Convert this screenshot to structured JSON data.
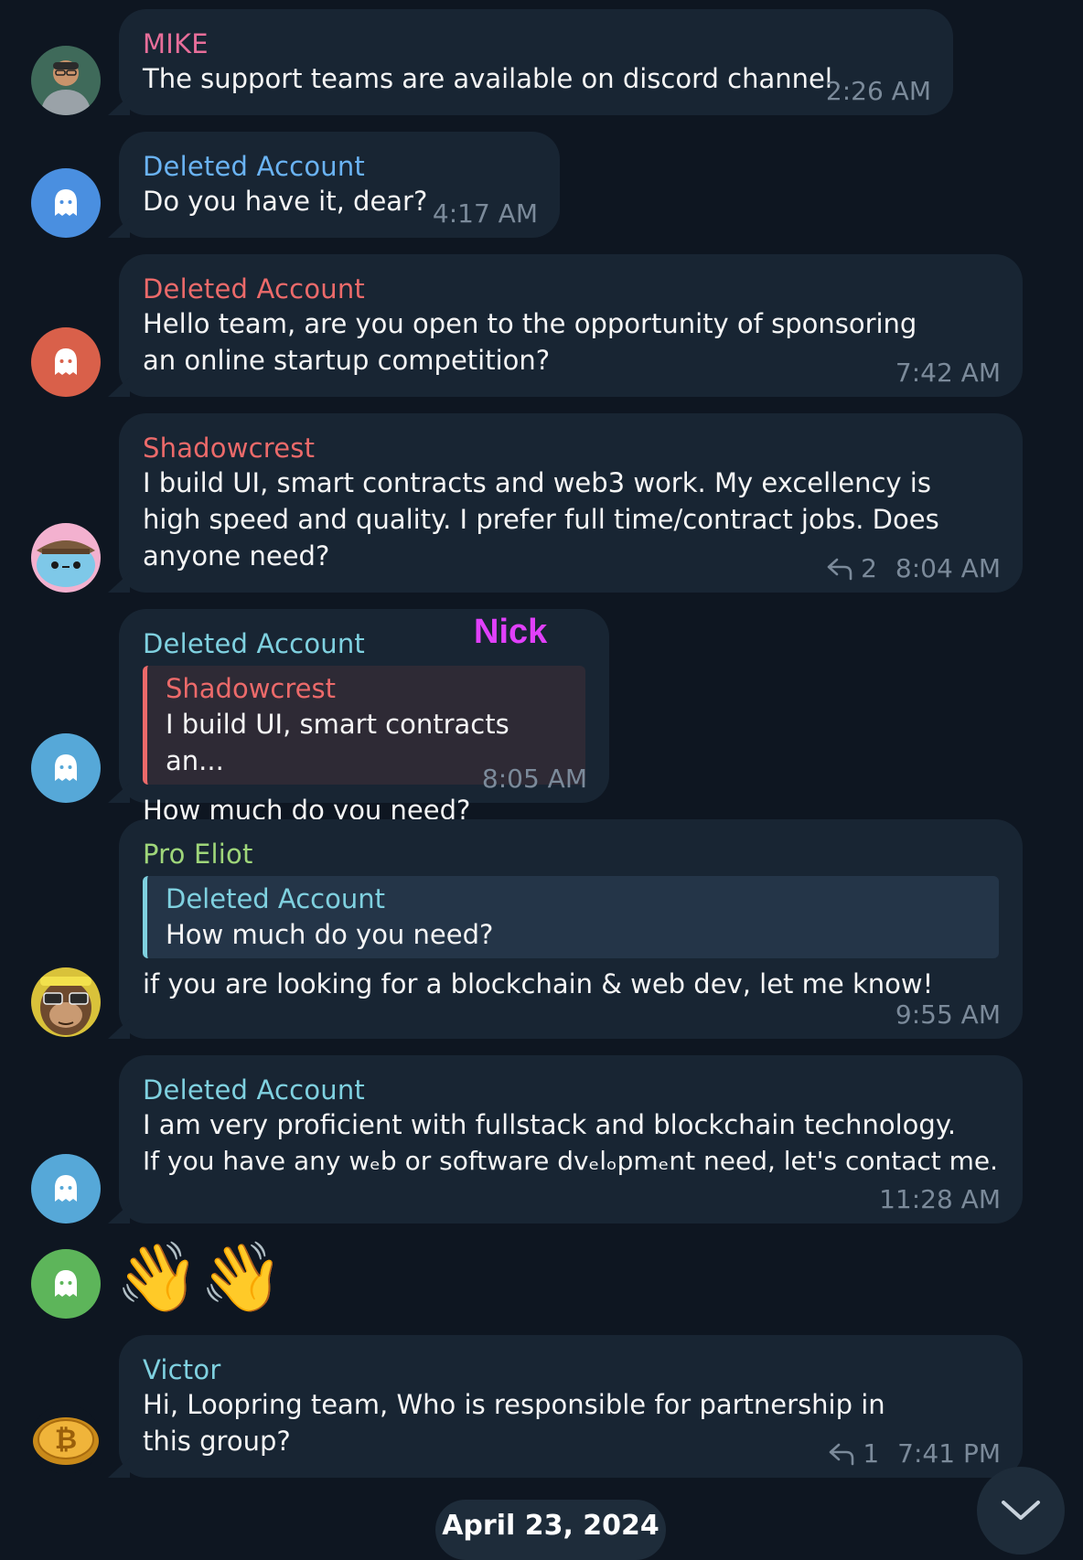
{
  "colors": {
    "background": "#0e1621",
    "bubble": "#182533",
    "timestamp": "#7b8a9a",
    "mike": "#e86e9a",
    "blue_name": "#6ab3f3",
    "red_name": "#ec6a6a",
    "cyan_name": "#7fd1e0",
    "green_name": "#9fd67a",
    "nick_annotation": "#e040fb"
  },
  "messages": [
    {
      "sender": "MIKE",
      "text": "The support teams are available on discord channel",
      "time": "2:26 AM",
      "avatar_icon": "user-photo-avatar"
    },
    {
      "sender": "Deleted Account",
      "text": "Do you have it, dear?",
      "time": "4:17 AM",
      "avatar_icon": "ghost-icon"
    },
    {
      "sender": "Deleted Account",
      "text": "Hello team, are you open to the opportunity of sponsoring an online startup competition?",
      "time": "7:42 AM",
      "avatar_icon": "ghost-icon"
    },
    {
      "sender": "Shadowcrest",
      "text": "I build UI, smart contracts and web3 work. My excellency is high speed and quality. I prefer full time/contract jobs. Does anyone need?",
      "time": "8:04 AM",
      "replies": "2",
      "avatar_icon": "cartoon-avatar"
    },
    {
      "sender": "Deleted Account",
      "annotation": "Nick",
      "quote": {
        "sender": "Shadowcrest",
        "text": "I build UI, smart contracts an..."
      },
      "text": "How much do you need?",
      "time": "8:05 AM",
      "avatar_icon": "ghost-icon"
    },
    {
      "sender": "Pro Eliot",
      "quote": {
        "sender": "Deleted Account",
        "text": "How much do you need?"
      },
      "text": "if you are looking for a blockchain & web dev, let me know!",
      "time": "9:55 AM",
      "avatar_icon": "ape-avatar"
    },
    {
      "sender": "Deleted Account",
      "text_line1": "I am very proficient with fullstack and blockchain technology.",
      "text_line2": "If you have any wₑb or software dvₑlₒpmₑnt need, let's contact me.",
      "time": "11:28 AM",
      "avatar_icon": "ghost-icon"
    },
    {
      "emoji": "👋👋",
      "avatar_icon": "ghost-icon"
    },
    {
      "sender": "Victor",
      "text": "Hi, Loopring team, Who is responsible for partnership in this group?",
      "time": "7:41 PM",
      "replies": "1",
      "avatar_icon": "bitcoin-avatar"
    }
  ],
  "date_separator": "April 23, 2024",
  "scroll_button_icon": "chevron-down-icon"
}
